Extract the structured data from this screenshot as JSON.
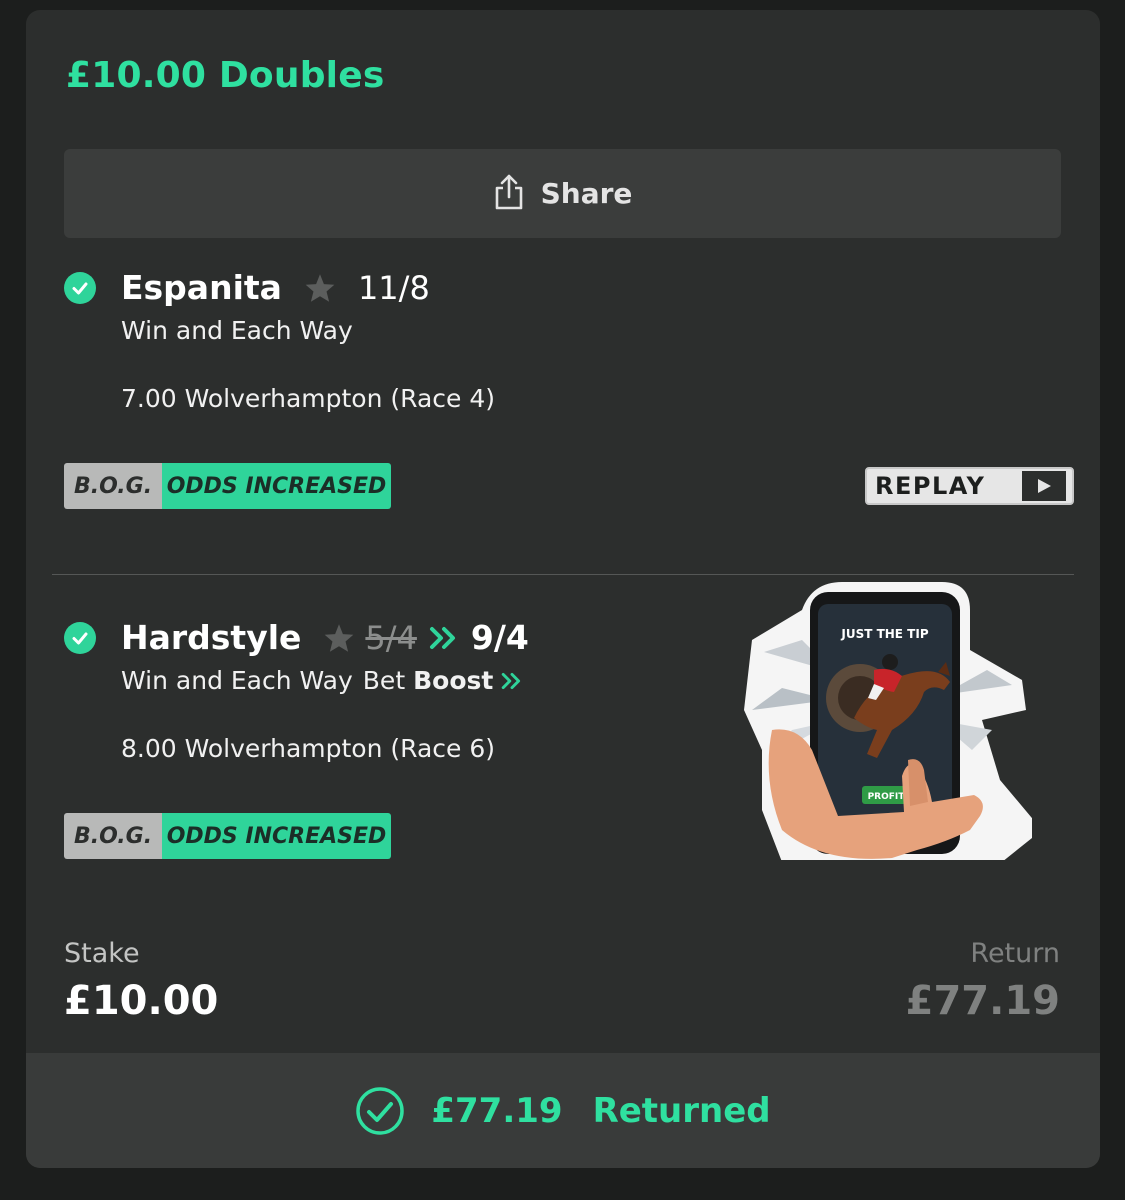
{
  "bet": {
    "title": "£10.00 Doubles",
    "share_label": "Share"
  },
  "legs": [
    {
      "selection": "Espanita",
      "odds": "11/8",
      "market": "Win and Each Way",
      "event": "7.00 Wolverhampton (Race 4)",
      "status": "won"
    },
    {
      "selection": "Hardstyle",
      "odds_old": "5/4",
      "odds_new": "9/4",
      "market": "Win and Each Way",
      "boost_prefix": "Bet",
      "boost_word": "Boost",
      "event": "8.00 Wolverhampton (Race 6)",
      "status": "won"
    }
  ],
  "badges": {
    "bog": "B.O.G.",
    "odds_increased": "ODDS INCREASED"
  },
  "replay_label": "REPLAY",
  "sticker": {
    "header": "JUST THE TIP",
    "button": "PROFIT"
  },
  "summary": {
    "stake_label": "Stake",
    "stake_value": "£10.00",
    "return_label": "Return",
    "return_value": "£77.19"
  },
  "footer": {
    "amount": "£77.19",
    "status": "Returned"
  },
  "colors": {
    "accent": "#2fe0a0",
    "card_bg": "#2c2e2d",
    "page_bg": "#1c1e1d"
  },
  "icons": {
    "share": "share-icon",
    "check": "check-circle-icon",
    "star": "star-icon",
    "boost": "double-chevron-icon",
    "play": "play-icon"
  }
}
